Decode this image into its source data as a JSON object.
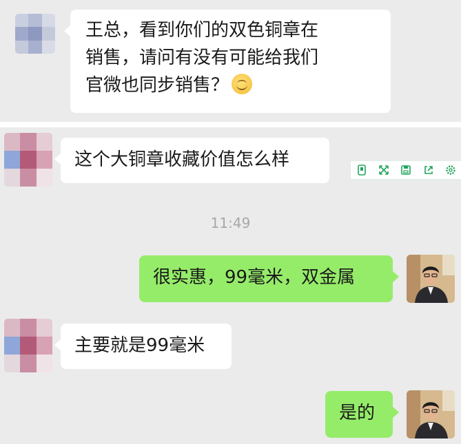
{
  "messages": [
    {
      "side": "left",
      "lines": [
        "王总，看到你们的双色铜章在",
        "销售，请问有没有可能给我们",
        "官微也同步销售？"
      ],
      "emoji": "smiling-face"
    },
    {
      "side": "left",
      "text": "这个大铜章收藏价值怎么样"
    },
    {
      "side": "right",
      "text": "很实惠，99毫米，双金属"
    },
    {
      "side": "left",
      "text": "主要就是99毫米"
    },
    {
      "side": "right",
      "text": "是的"
    }
  ],
  "timestamp": "11:49",
  "toolbar": {
    "icons": [
      "phone-icon",
      "fullscreen-icon",
      "save-icon",
      "share-icon",
      "settings-icon"
    ],
    "color": "#22a55b"
  },
  "colors": {
    "background": "#ebebeb",
    "left_bubble": "#ffffff",
    "right_bubble": "#95ec69",
    "timestamp": "#a8a8a8"
  }
}
